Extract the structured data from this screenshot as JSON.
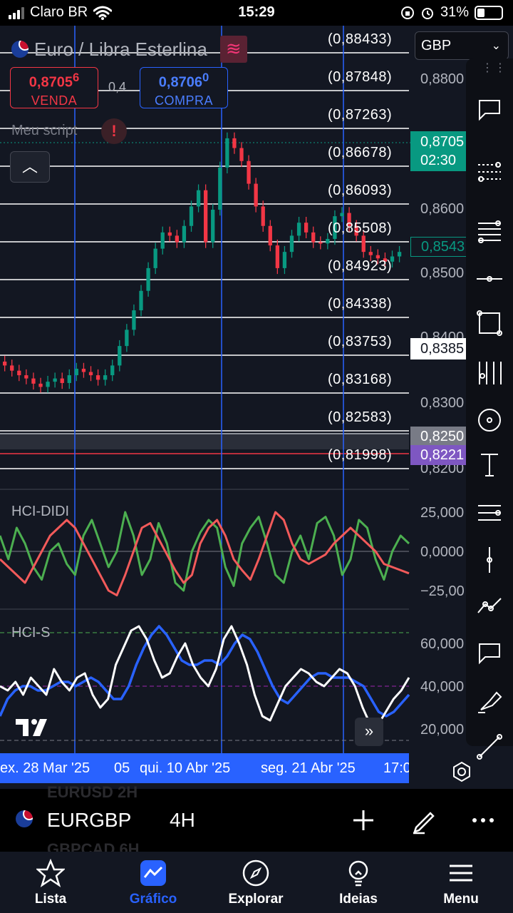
{
  "status_bar": {
    "carrier": "Claro BR",
    "time": "15:29",
    "battery": "31%",
    "icons": [
      "signal-icon",
      "wifi-icon",
      "orientation-lock-icon",
      "alarm-icon",
      "battery-icon"
    ]
  },
  "header": {
    "pair_name": "Euro / Libra Esterlina",
    "sell_price": "0,8705",
    "sell_price_sup": "6",
    "sell_label": "VENDA",
    "spread": "0,4",
    "buy_price": "0,8706",
    "buy_price_sup": "0",
    "buy_label": "COMPRA",
    "script_label": "Meu script",
    "alert_glyph": "!",
    "currency": "GBP"
  },
  "fib_levels": [
    "(0,88433)",
    "(0,87848)",
    "(0,87263)",
    "(0,86678)",
    "(0,86093)",
    "(0,85508)",
    "(0,84923)",
    "(0,84338)",
    "(0,83753)",
    "(0,83168)",
    "(0,82583)",
    "(0,81998)"
  ],
  "price_axis": {
    "labels": [
      "0,8800",
      "0,8600",
      "0,8500",
      "0,8400",
      "0,8300",
      "0,8200"
    ],
    "tag_current_price": "0,8705",
    "tag_countdown": "02:30",
    "tag_outline": "0,8543",
    "tag_white": "0,8385",
    "tag_grey": "0,8250",
    "tag_purple": "0,8221"
  },
  "indicators": {
    "hci_didi": {
      "name": "HCI-DIDI",
      "axis": [
        "25,000",
        "0,0000",
        "−25,00"
      ]
    },
    "hci_s": {
      "name": "HCI-S",
      "axis": [
        "60,000",
        "40,000",
        "20,000"
      ]
    }
  },
  "time_axis": {
    "labels": [
      "ex. 28 Mar '25",
      "05",
      "qui. 10 Abr '25",
      "seg. 21 Abr '25",
      "17:0"
    ]
  },
  "symbol_bar": {
    "symbol": "EURGBP",
    "interval": "4H",
    "ghost_above": "EURUSD   2H",
    "ghost_below": "GBPCAD   6H"
  },
  "tabs": [
    {
      "label": "Lista",
      "icon": "star-icon"
    },
    {
      "label": "Gráfico",
      "icon": "chart-icon"
    },
    {
      "label": "Explorar",
      "icon": "compass-icon"
    },
    {
      "label": "Ideias",
      "icon": "lightbulb-icon"
    },
    {
      "label": "Menu",
      "icon": "menu-icon"
    }
  ],
  "colors": {
    "background": "#131722",
    "up": "#089981",
    "down": "#f23645",
    "accent": "#2962ff"
  },
  "chart_data": {
    "type": "candlestick",
    "symbol": "EURGBP",
    "interval": "4H",
    "series": [
      {
        "name": "price",
        "values": [
          0.836,
          0.8352,
          0.8345,
          0.834,
          0.8332,
          0.8327,
          0.8335,
          0.834,
          0.8333,
          0.8345,
          0.8355,
          0.835,
          0.8345,
          0.8338,
          0.8345,
          0.836,
          0.839,
          0.8415,
          0.8445,
          0.8475,
          0.851,
          0.854,
          0.8565,
          0.856,
          0.855,
          0.8575,
          0.8605,
          0.863,
          0.855,
          0.86,
          0.8665,
          0.871,
          0.8695,
          0.8675,
          0.864,
          0.8605,
          0.8575,
          0.8545,
          0.851,
          0.8535,
          0.856,
          0.858,
          0.8565,
          0.855,
          0.8548,
          0.8555,
          0.859,
          0.8595,
          0.8575,
          0.856,
          0.8535,
          0.853,
          0.8525,
          0.852,
          0.8528,
          0.8535
        ]
      },
      {
        "name": "HCI-DIDI green",
        "values": [
          10,
          -5,
          15,
          5,
          -10,
          -18,
          0,
          5,
          -8,
          -15,
          10,
          20,
          5,
          -10,
          0,
          25,
          10,
          -15,
          -5,
          18,
          5,
          -20,
          -25,
          0,
          12,
          20,
          15,
          -10,
          -22,
          5,
          15,
          22,
          5,
          -15,
          -20,
          0,
          10,
          -5,
          18,
          22,
          10,
          -15,
          -5,
          20,
          15,
          -5,
          -18,
          0,
          10,
          5
        ]
      },
      {
        "name": "HCI-DIDI red",
        "values": [
          -5,
          -10,
          -15,
          -20,
          -10,
          0,
          10,
          15,
          20,
          15,
          5,
          -5,
          -15,
          -25,
          -28,
          -15,
          0,
          15,
          18,
          8,
          -2,
          -12,
          -20,
          -15,
          5,
          15,
          20,
          10,
          -5,
          -12,
          -18,
          -5,
          10,
          25,
          20,
          5,
          -5,
          -8,
          -5,
          -2,
          5,
          10,
          15,
          10,
          5,
          0,
          -8,
          -10,
          -12,
          -14
        ]
      },
      {
        "name": "HCI-S white",
        "values": [
          40,
          38,
          42,
          36,
          44,
          40,
          36,
          48,
          42,
          38,
          44,
          46,
          36,
          30,
          34,
          50,
          58,
          66,
          68,
          62,
          52,
          44,
          46,
          54,
          60,
          50,
          44,
          40,
          48,
          62,
          68,
          60,
          50,
          36,
          26,
          24,
          32,
          40,
          44,
          48,
          46,
          42,
          40,
          44,
          48,
          46,
          40,
          30,
          22,
          22,
          28,
          34,
          38,
          44
        ]
      },
      {
        "name": "HCI-S blue",
        "values": [
          26,
          34,
          38,
          40,
          40,
          38,
          38,
          40,
          42,
          42,
          40,
          42,
          44,
          42,
          38,
          34,
          34,
          40,
          50,
          58,
          64,
          68,
          64,
          58,
          52,
          50,
          50,
          52,
          52,
          50,
          54,
          60,
          64,
          62,
          56,
          48,
          40,
          34,
          32,
          36,
          40,
          44,
          46,
          46,
          44,
          44,
          44,
          42,
          40,
          34,
          28,
          26,
          28,
          32,
          36
        ]
      }
    ]
  }
}
